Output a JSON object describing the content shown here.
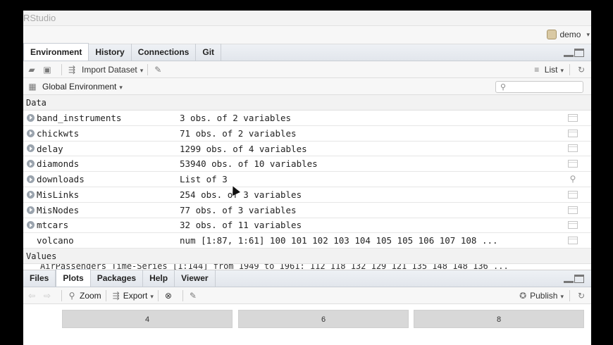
{
  "app": {
    "title": "RStudio"
  },
  "project": {
    "name": "demo",
    "caret": "▾"
  },
  "env_pane": {
    "tabs": [
      {
        "label": "Environment",
        "active": true
      },
      {
        "label": "History"
      },
      {
        "label": "Connections"
      },
      {
        "label": "Git"
      }
    ],
    "toolbar": {
      "import_label": "Import Dataset",
      "list_label": "List"
    },
    "scope": {
      "label": "Global Environment",
      "search_placeholder": ""
    },
    "data_header": "Data",
    "values_header": "Values",
    "rows": [
      {
        "name": "band_instruments",
        "value": "3 obs. of 2 variables",
        "expand": true,
        "view": "grid"
      },
      {
        "name": "chickwts",
        "value": "71 obs. of 2 variables",
        "expand": true,
        "view": "grid"
      },
      {
        "name": "delay",
        "value": "1299 obs. of 4 variables",
        "expand": true,
        "view": "grid"
      },
      {
        "name": "diamonds",
        "value": "53940 obs. of 10 variables",
        "expand": true,
        "view": "grid"
      },
      {
        "name": "downloads",
        "value": "List of 3",
        "expand": true,
        "view": "search"
      },
      {
        "name": "MisLinks",
        "value": "254 obs. of 3 variables",
        "expand": true,
        "view": "grid"
      },
      {
        "name": "MisNodes",
        "value": "77 obs. of 3 variables",
        "expand": true,
        "view": "grid"
      },
      {
        "name": "mtcars",
        "value": "32 obs. of 11 variables",
        "expand": true,
        "view": "grid"
      },
      {
        "name": "volcano",
        "value": "num [1:87, 1:61] 100 101 102 103 104 105 105 106 107 108 ...",
        "expand": false,
        "view": "grid"
      }
    ],
    "values_row_partial": "AirPassengers   Time-Series [1:144] from 1949 to 1961: 112 118 132 129 121 135 148 148 136 ..."
  },
  "files_pane": {
    "tabs": [
      {
        "label": "Files"
      },
      {
        "label": "Plots",
        "active": true
      },
      {
        "label": "Packages"
      },
      {
        "label": "Help"
      },
      {
        "label": "Viewer"
      }
    ],
    "toolbar": {
      "zoom_label": "Zoom",
      "export_label": "Export",
      "publish_label": "Publish"
    },
    "plot_buttons": [
      "4",
      "6",
      "8"
    ]
  }
}
